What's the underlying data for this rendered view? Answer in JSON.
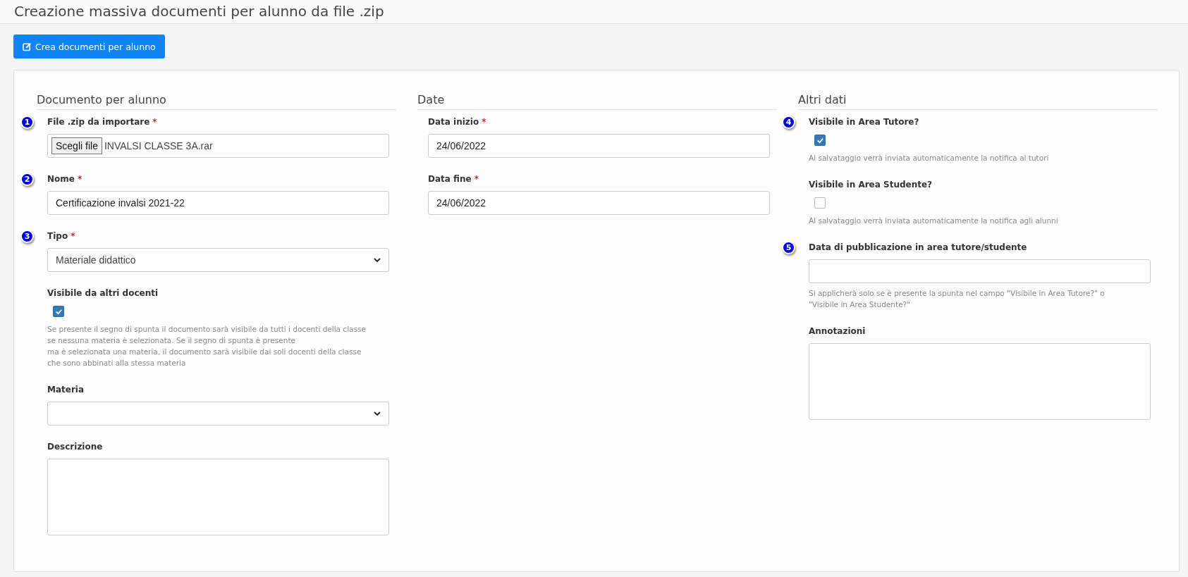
{
  "title": "Creazione massiva documenti per alunno da file .zip",
  "action_button": {
    "label": "Crea documenti per alunno"
  },
  "sections": [
    {
      "heading": "Documento per alunno",
      "fields": [
        {
          "kind": "file",
          "badge": "1",
          "label": "File .zip da importare",
          "required_mark": "*",
          "button": "Scegli file",
          "value": "INVALSI CLASSE 3A.rar"
        },
        {
          "kind": "text",
          "badge": "2",
          "label": "Nome",
          "required_mark": "*",
          "value": "Certificazione invalsi 2021-22"
        },
        {
          "kind": "select",
          "badge": "3",
          "label": "Tipo",
          "required_mark": "*",
          "value": "Materiale didattico"
        },
        {
          "kind": "checkbox",
          "label": "Visibile da altri docenti",
          "checked": true,
          "help": "Se presente il segno di spunta il documento sarà visibile da tutti i docenti della classe\nse nessuna materia è selezionata. Se il segno di spunta è presente\nma è selezionata una materia, il documento sarà visibile dai soli docenti della classe\nche sono abbinati alla stessa materia"
        },
        {
          "kind": "select",
          "label": "Materia"
        },
        {
          "kind": "textarea",
          "label": "Descrizione"
        }
      ]
    },
    {
      "heading": "Date",
      "fields": [
        {
          "kind": "text",
          "label": "Data inizio",
          "required_mark": "*",
          "value": "24/06/2022"
        },
        {
          "kind": "text",
          "label": "Data fine",
          "required_mark": "*",
          "value": "24/06/2022"
        }
      ]
    },
    {
      "heading": "Altri dati",
      "fields": [
        {
          "kind": "checkbox",
          "badge": "4",
          "label": "Visibile in Area Tutore?",
          "checked": true,
          "help": "Al salvataggio verrà inviata automaticamente la notifica ai tutori"
        },
        {
          "kind": "checkbox",
          "label": "Visibile in Area Studente?",
          "checked": false,
          "help": "Al salvataggio verrà inviata automaticamente la notifica agli alunni"
        },
        {
          "kind": "text",
          "badge": "5",
          "label": "Data di pubblicazione in area tutore/studente",
          "help": "Si applicherà solo se è presente la spunta nel campo \"Visibile in Area Tutore?\" o\n\"Visibile in Area Studente?\""
        },
        {
          "kind": "textarea",
          "label": "Annotazioni"
        }
      ]
    }
  ]
}
